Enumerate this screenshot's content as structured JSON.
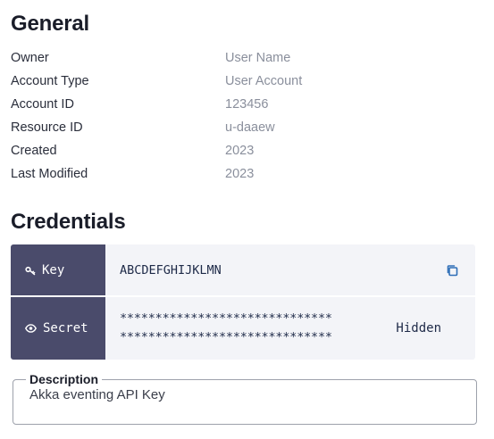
{
  "general": {
    "title": "General",
    "rows": [
      {
        "label": "Owner",
        "value": "User Name"
      },
      {
        "label": "Account Type",
        "value": "User Account"
      },
      {
        "label": "Account ID",
        "value": "123456"
      },
      {
        "label": "Resource ID",
        "value": "u-daaew"
      },
      {
        "label": "Created",
        "value": "2023"
      },
      {
        "label": "Last Modified",
        "value": "2023"
      }
    ]
  },
  "credentials": {
    "title": "Credentials",
    "key": {
      "label": "Key",
      "value": "ABCDEFGHIJKLMN",
      "icon": "key-icon",
      "action_icon": "copy-icon"
    },
    "secret": {
      "label": "Secret",
      "value_line1": "******************************",
      "value_line2": "******************************",
      "status": "Hidden",
      "icon": "eye-icon"
    }
  },
  "description": {
    "legend": "Description",
    "text": "Akka eventing API Key"
  },
  "colors": {
    "label_bg": "#4a4b6b",
    "row_bg": "#f3f4f8",
    "accent": "#2f6fb8"
  }
}
